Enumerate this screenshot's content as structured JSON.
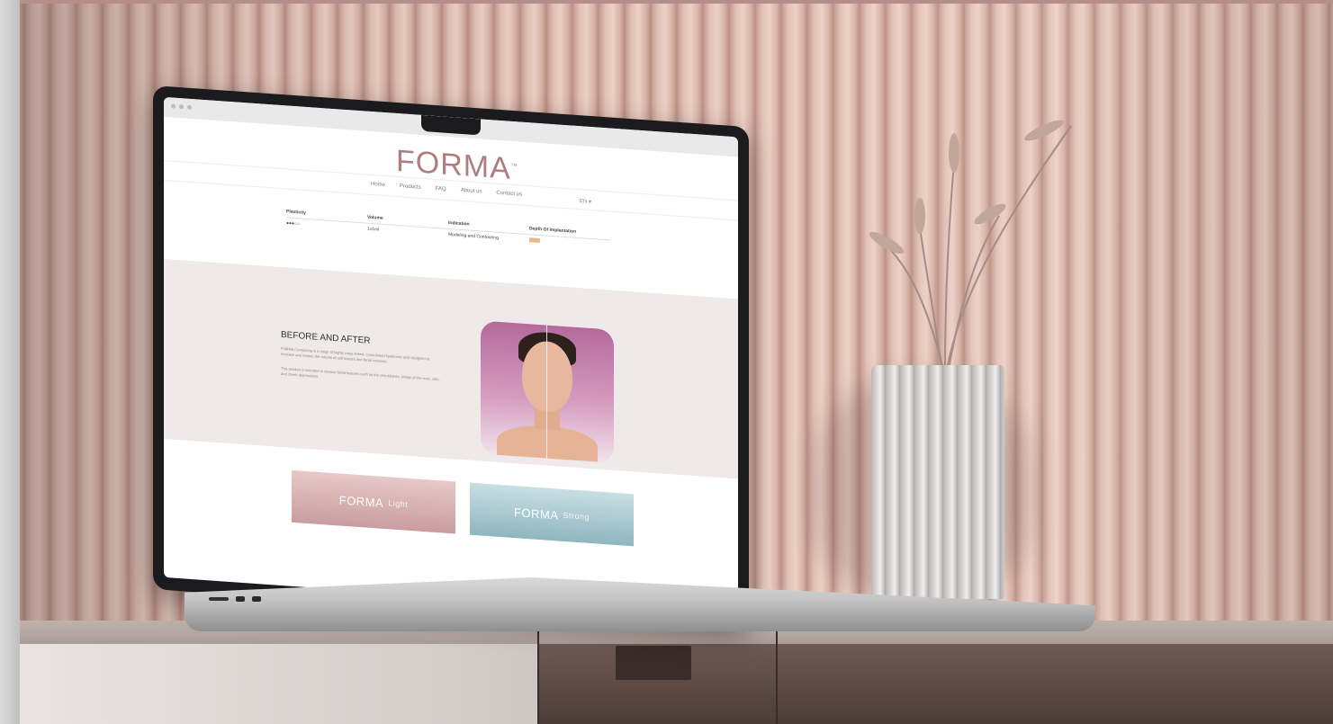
{
  "site": {
    "logo_text": "FORMA",
    "logo_mark": "™",
    "nav": [
      "Home",
      "Products",
      "FAQ",
      "About us",
      "Contact us"
    ],
    "language": "EN ▾"
  },
  "spec_table": {
    "headers": [
      "Plasticity",
      "Volume",
      "Indication",
      "Depth Of Implantation"
    ],
    "row": [
      "●●●○○",
      "1x1ml",
      "Modeling and Contouring",
      ""
    ]
  },
  "before_after": {
    "title": "BEFORE AND AFTER",
    "paragraph_1": "FORMA Contouring is a range of highly cross-linked, cross-linked hyaluronic acid designed to increase and restore the volume of soft tissues and facial contours.",
    "paragraph_2": "This product is intended to contour facial features such as the cheekbones, bridge of the nose, chin, and cheek depressions."
  },
  "product_cards": [
    {
      "name": "FORMA",
      "variant": "Light"
    },
    {
      "name": "FORMA",
      "variant": "Strong"
    }
  ],
  "colors": {
    "brand_rose": "#b07d7d",
    "light_card": "#c99d9f",
    "strong_card": "#8fb6bf",
    "wall": "#e2c1b6"
  }
}
